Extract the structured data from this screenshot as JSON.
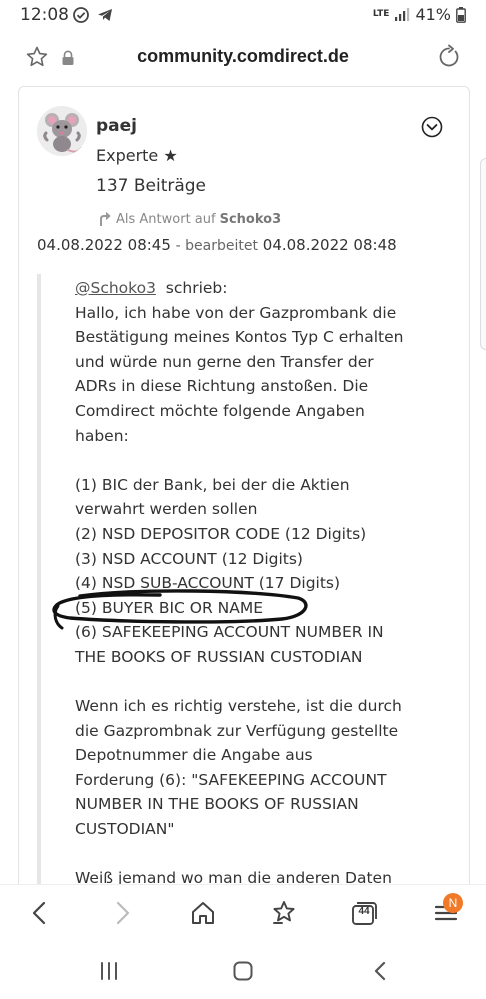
{
  "status_bar": {
    "time": "12:08",
    "network_label": "LTE",
    "battery_percent": "41%"
  },
  "browser": {
    "url": "community.comdirect.de"
  },
  "post": {
    "username": "paej",
    "rank": "Experte ★",
    "post_count": "137 Beiträge",
    "reply_to_prefix": "Als Antwort auf",
    "reply_to_user": "Schoko3",
    "posted_at": "04.08.2022 08:45",
    "edited_label": "- bearbeitet",
    "edited_at": "04.08.2022 08:48",
    "quote_author": "@Schoko3",
    "quote_wrote": "schrieb:",
    "quote_paragraph_1": [
      "Hallo, ich habe von der Gazprombank die",
      "Bestätigung meines Kontos Typ C erhalten",
      "und würde nun gerne den Transfer der",
      "ADRs in diese Richtung anstoßen. Die",
      "Comdirect möchte folgende Angaben",
      "haben:"
    ],
    "quote_list": [
      "(1) BIC der Bank, bei der die Aktien",
      "verwahrt werden sollen",
      "(2) NSD DEPOSITOR CODE (12 Digits)",
      "(3) NSD ACCOUNT (12 Digits)",
      "(4) NSD SUB-ACCOUNT (17 Digits)",
      "(5) BUYER BIC OR NAME",
      "(6) SAFEKEEPING ACCOUNT NUMBER IN",
      "THE BOOKS OF RUSSIAN CUSTODIAN"
    ],
    "quote_paragraph_2": [
      "Wenn ich es richtig verstehe, ist die durch",
      "die Gazprombnak zur Verfügung gestellte",
      "Depotnummer die Angabe aus",
      "Forderung (6): \"SAFEKEEPING ACCOUNT",
      "NUMBER IN THE BOOKS OF RUSSIAN",
      "CUSTODIAN\""
    ],
    "quote_paragraph_3": [
      "Weiß jemand wo man die anderen Daten"
    ]
  },
  "toolbar": {
    "tab_count": "44",
    "menu_badge": "N"
  },
  "icons": {
    "star": "bookmark-star-icon",
    "lock": "lock-icon",
    "reload": "reload-icon",
    "chevron": "chevron-down-circle-icon",
    "back": "back-arrow-icon",
    "forward": "forward-arrow-icon",
    "home": "home-icon",
    "bookmarks": "bookmarks-star-icon",
    "tabs": "tabs-icon",
    "menu": "menu-icon"
  },
  "colors": {
    "badge": "#f07a28",
    "quote_bar": "#e6e6e6",
    "scribble": "#111111"
  }
}
